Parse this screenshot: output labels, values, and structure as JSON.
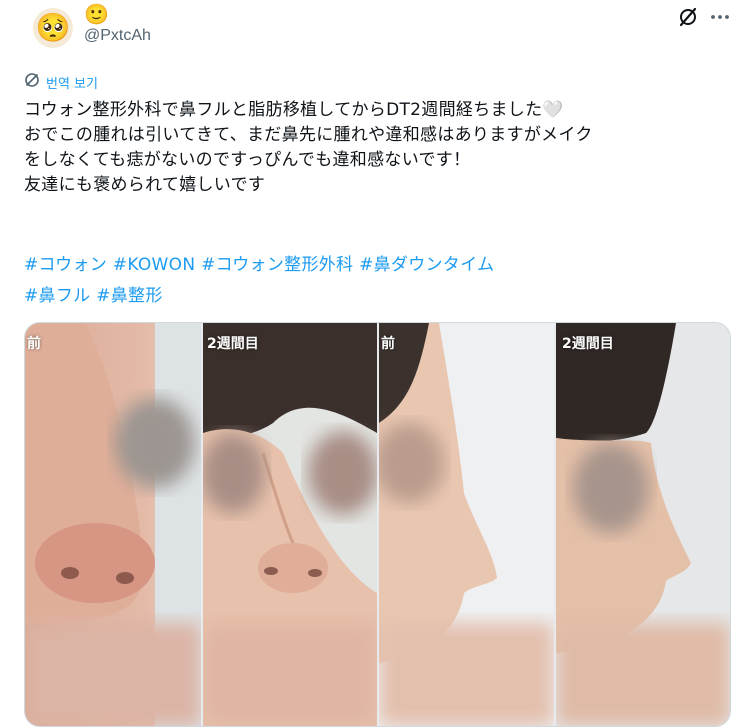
{
  "author": {
    "avatar_emoji": "🥺",
    "display_name": "🙂",
    "handle": "@PxtcAh"
  },
  "icons": {
    "grok": "grok-icon",
    "more": "more-icon",
    "translate": "translate-icon"
  },
  "translate_label": "번역 보기",
  "post": {
    "lines": [
      "コウォン整形外科で鼻フルと脂肪移植してからDT2週間経ちました🤍",
      "おでこの腫れは引いてきて、まだ鼻先に腫れや違和感はありますがメイク",
      "をしなくても痣がないのですっぴんでも違和感ないです！",
      "友達にも褒められて嬉しいです"
    ],
    "hashtags_row1": [
      "#コウォン",
      "#KOWON",
      "#コウォン整形外科",
      "#鼻ダウンタイム"
    ],
    "hashtags_row2": [
      "#鼻フル",
      "#鼻整形"
    ]
  },
  "media": {
    "panels": [
      {
        "label": "前"
      },
      {
        "label": "2週間目"
      },
      {
        "label": "前"
      },
      {
        "label": "2週間目"
      }
    ]
  },
  "colors": {
    "link": "#1d9bf0",
    "text": "#0f1419",
    "secondary": "#536471",
    "border": "#cfd9de"
  }
}
